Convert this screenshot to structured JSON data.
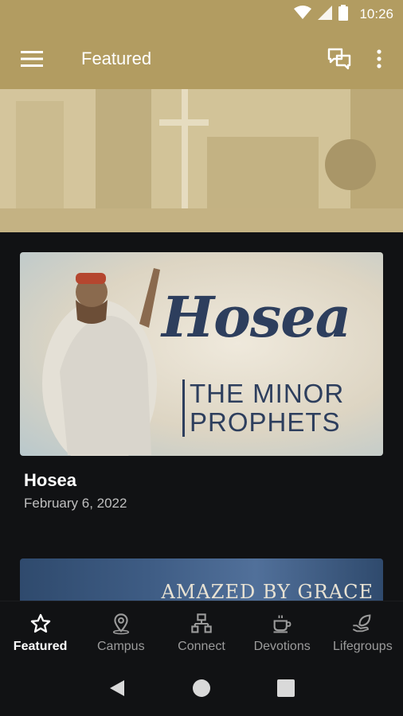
{
  "status_bar": {
    "time": "10:26"
  },
  "app_bar": {
    "title": "Featured"
  },
  "cards": [
    {
      "image_title": "Hosea",
      "image_series": "THE MINOR PROPHETS",
      "title": "Hosea",
      "date": "February 6, 2022"
    },
    {
      "image_text": "AMAZED BY GRACE"
    }
  ],
  "bottom_nav": [
    {
      "label": "Featured",
      "icon": "star-icon",
      "active": true
    },
    {
      "label": "Campus",
      "icon": "location-pin-icon",
      "active": false
    },
    {
      "label": "Connect",
      "icon": "people-network-icon",
      "active": false
    },
    {
      "label": "Devotions",
      "icon": "coffee-cup-icon",
      "active": false
    },
    {
      "label": "Lifegroups",
      "icon": "leaf-hand-icon",
      "active": false
    }
  ],
  "colors": {
    "brand": "#b29c61",
    "background": "#111214",
    "accent_text": "#2d3e5d"
  }
}
